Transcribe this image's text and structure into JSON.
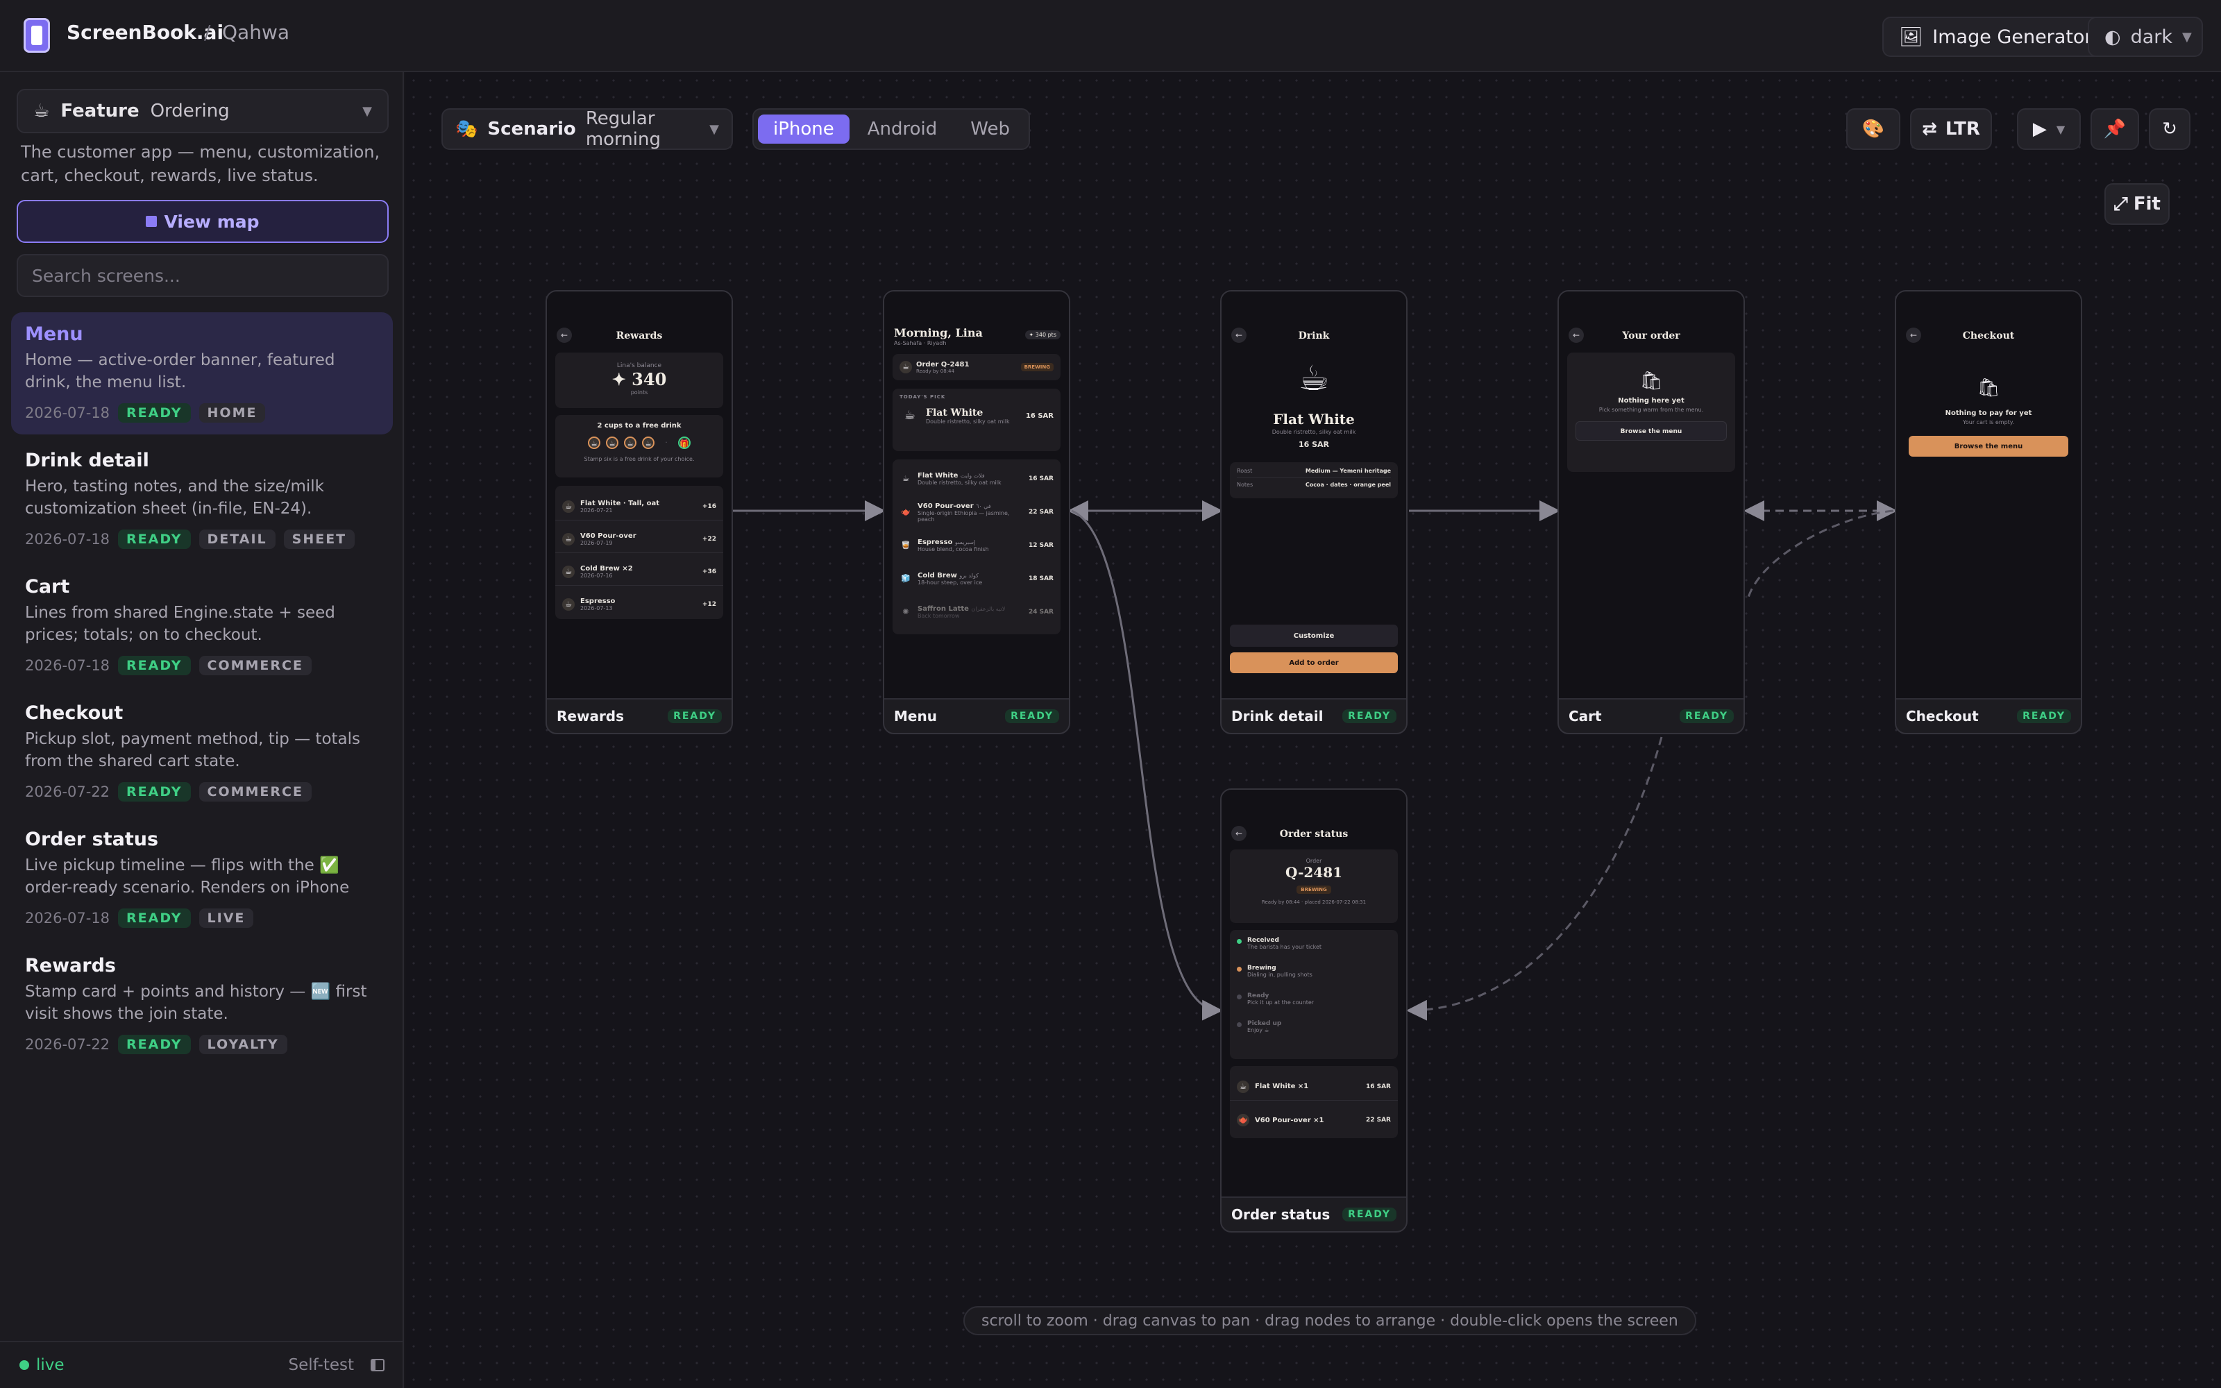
{
  "app": {
    "brand": "ScreenBook.ai",
    "project": "Qahwa",
    "image_generator": "Image Generator",
    "theme": "dark"
  },
  "sidebar": {
    "feature_label": "Feature",
    "feature_value": "Ordering",
    "description": "The customer app — menu, customization, cart, checkout, rewards, live status.",
    "view_map": "View map",
    "search_placeholder": "Search screens...",
    "items": [
      {
        "title": "Menu",
        "desc": "Home — active-order banner, featured drink, the menu list.",
        "date": "2026-07-18",
        "status": "READY",
        "tags": [
          "HOME"
        ]
      },
      {
        "title": "Drink detail",
        "desc": "Hero, tasting notes, and the size/milk customization sheet (in-file, EN-24).",
        "date": "2026-07-18",
        "status": "READY",
        "tags": [
          "DETAIL",
          "SHEET"
        ]
      },
      {
        "title": "Cart",
        "desc": "Lines from shared Engine.state + seed prices; totals; on to checkout.",
        "date": "2026-07-18",
        "status": "READY",
        "tags": [
          "COMMERCE"
        ]
      },
      {
        "title": "Checkout",
        "desc": "Pickup slot, payment method, tip — totals from the shared cart state.",
        "date": "2026-07-22",
        "status": "READY",
        "tags": [
          "COMMERCE"
        ]
      },
      {
        "title": "Order status",
        "desc": "Live pickup timeline — flips with the ✅ order-ready scenario. Renders on iPhone AND...",
        "date": "2026-07-18",
        "status": "READY",
        "tags": [
          "LIVE"
        ]
      },
      {
        "title": "Rewards",
        "desc": "Stamp card + points and history — 🆕 first visit shows the join state.",
        "date": "2026-07-22",
        "status": "READY",
        "tags": [
          "LOYALTY"
        ]
      }
    ],
    "footer": {
      "live": "live",
      "selftest": "Self-test"
    }
  },
  "toolbar": {
    "scenario_label": "Scenario",
    "scenario_value": "Regular morning",
    "platforms": [
      "iPhone",
      "Android",
      "Web"
    ],
    "direction": "LTR",
    "fit": "Fit"
  },
  "hint": "scroll to zoom · drag canvas to pan · drag nodes to arrange · double-click opens the screen",
  "nodes": {
    "rewards": {
      "label": "Rewards",
      "status": "READY",
      "title": "Rewards",
      "balance_label": "Lina's balance",
      "points": "✦ 340",
      "points_unit": "points",
      "cups_text": "2 cups to a free drink",
      "stamp_note": "Stamp six is a free drink of your choice.",
      "history": [
        {
          "name": "Flat White · Tall, oat",
          "date": "2026-07-21",
          "pts": "+16"
        },
        {
          "name": "V60 Pour-over",
          "date": "2026-07-19",
          "pts": "+22"
        },
        {
          "name": "Cold Brew ×2",
          "date": "2026-07-16",
          "pts": "+36"
        },
        {
          "name": "Espresso",
          "date": "2026-07-13",
          "pts": "+12"
        }
      ]
    },
    "menu": {
      "label": "Menu",
      "status": "READY",
      "greeting": "Morning, Lina",
      "location": "As-Sahafa · Riyadh",
      "pts_badge": "✦ 340 pts",
      "order": "Order Q-2481",
      "order_sub": "Ready by 08:44",
      "order_badge": "BREWING",
      "pick_label": "TODAY'S PICK",
      "pick_name": "Flat White",
      "pick_desc": "Double ristretto, silky oat milk",
      "pick_price": "16 SAR",
      "items": [
        {
          "name": "Flat White",
          "ar": "فلات وايت",
          "desc": "Double ristretto, silky oat milk",
          "price": "16 SAR"
        },
        {
          "name": "V60 Pour-over",
          "ar": "في ٦٠",
          "desc": "Single-origin Ethiopia — jasmine, peach",
          "price": "22 SAR"
        },
        {
          "name": "Espresso",
          "ar": "إسبريسو",
          "desc": "House blend, cocoa finish",
          "price": "12 SAR"
        },
        {
          "name": "Cold Brew",
          "ar": "كولد برو",
          "desc": "18-hour steep, over ice",
          "price": "18 SAR"
        },
        {
          "name": "Saffron Latte",
          "ar": "لاتيه بالزعفران",
          "desc": "Back tomorrow",
          "price": "24 SAR"
        }
      ]
    },
    "drink": {
      "label": "Drink detail",
      "status": "READY",
      "title": "Drink",
      "name": "Flat White",
      "desc": "Double ristretto, silky oat milk",
      "price": "16 SAR",
      "roast_label": "Roast",
      "roast": "Medium — Yemeni heritage",
      "notes_label": "Notes",
      "notes": "Cocoa · dates · orange peel",
      "customize": "Customize",
      "add": "Add to order"
    },
    "cart": {
      "label": "Cart",
      "status": "READY",
      "title": "Your order",
      "empty": "Nothing here yet",
      "empty_sub": "Pick something warm from the menu.",
      "browse": "Browse the menu"
    },
    "checkout": {
      "label": "Checkout",
      "status": "READY",
      "title": "Checkout",
      "empty": "Nothing to pay for yet",
      "empty_sub": "Your cart is empty.",
      "browse": "Browse the menu"
    },
    "status": {
      "label": "Order status",
      "status": "READY",
      "title": "Order status",
      "order_label": "Order",
      "order": "Q-2481",
      "badge": "BREWING",
      "eta": "Ready by 08:44 · placed 2026-07-22 08:31",
      "steps": [
        {
          "name": "Received",
          "sub": "The barista has your ticket"
        },
        {
          "name": "Brewing",
          "sub": "Dialing in, pulling shots"
        },
        {
          "name": "Ready",
          "sub": "Pick it up at the counter"
        },
        {
          "name": "Picked up",
          "sub": "Enjoy ☕"
        }
      ],
      "lines": [
        {
          "name": "Flat White ×1",
          "price": "16 SAR"
        },
        {
          "name": "V60 Pour-over ×1",
          "price": "22 SAR"
        }
      ]
    }
  },
  "colors": {
    "accent": "#7c6cf0",
    "ready": "#3fcf85",
    "orange": "#d9925a"
  }
}
